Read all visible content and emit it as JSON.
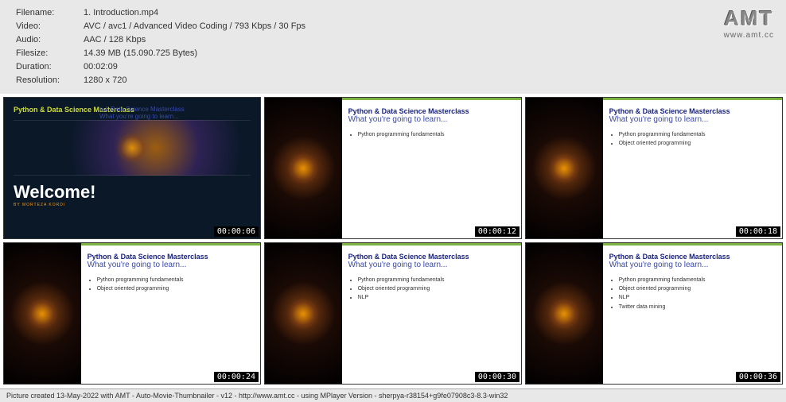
{
  "meta": {
    "labels": {
      "filename": "Filename:",
      "video": "Video:",
      "audio": "Audio:",
      "filesize": "Filesize:",
      "duration": "Duration:",
      "resolution": "Resolution:"
    },
    "filename": "1. Introduction.mp4",
    "video": "AVC / avc1 / Advanced Video Coding / 793 Kbps / 30 Fps",
    "audio": "AAC / 128 Kbps",
    "filesize": "14.39 MB (15.090.725 Bytes)",
    "duration": "00:02:09",
    "resolution": "1280 x 720"
  },
  "logo": {
    "text": "AMT",
    "url": "www.amt.cc"
  },
  "slides": {
    "course_title": "Python & Data Science Masterclass",
    "overlay_sub": "n & Data Science Masterclass",
    "subtitle": "What you're going to learn...",
    "welcome": "Welcome!",
    "by": "BY MORTEZA KORDI",
    "bullets": {
      "b1": "Python programming fundamentals",
      "b2": "Object oriented programming",
      "b3": "NLP",
      "b4": "Twitter data mining"
    }
  },
  "timestamps": {
    "t1": "00:00:06",
    "t2": "00:00:12",
    "t3": "00:00:18",
    "t4": "00:00:24",
    "t5": "00:00:30",
    "t6": "00:00:36"
  },
  "footer": "Picture created 13-May-2022 with AMT - Auto-Movie-Thumbnailer - v12 - http://www.amt.cc - using MPlayer Version - sherpya-r38154+g9fe07908c3-8.3-win32"
}
